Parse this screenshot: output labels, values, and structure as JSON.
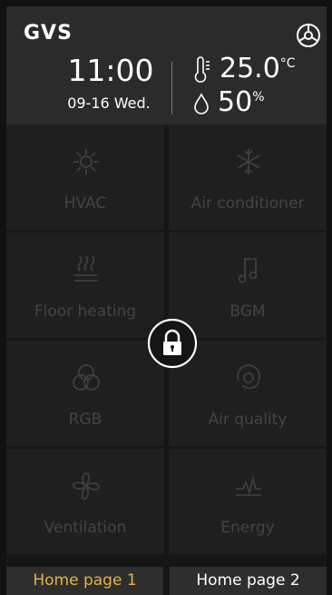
{
  "header": {
    "logo": "GVS",
    "time": "11:00",
    "date": "09-16  Wed.",
    "temperature": "25.0",
    "temperature_unit": "°C",
    "humidity": "50",
    "humidity_unit": "%"
  },
  "tiles": [
    {
      "label": "HVAC",
      "icon": "hvac-icon"
    },
    {
      "label": "Air conditioner",
      "icon": "snowflake-icon"
    },
    {
      "label": "Floor heating",
      "icon": "floor-heating-icon"
    },
    {
      "label": "BGM",
      "icon": "music-note-icon"
    },
    {
      "label": "RGB",
      "icon": "rgb-circles-icon"
    },
    {
      "label": "Air quality",
      "icon": "air-quality-icon"
    },
    {
      "label": "Ventilation",
      "icon": "fan-icon"
    },
    {
      "label": "Energy",
      "icon": "energy-pulse-icon"
    }
  ],
  "tabs": [
    {
      "label": "Home page 1",
      "active": true
    },
    {
      "label": "Home page 2",
      "active": false
    }
  ],
  "colors": {
    "active_tab": "#e3b24a",
    "tile_text_disabled": "#444444",
    "tile_background": "#1f1f1f",
    "header_background": "#2b2b2b"
  }
}
